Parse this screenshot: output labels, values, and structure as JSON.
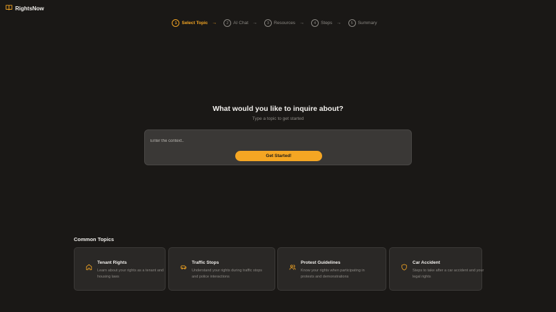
{
  "app": {
    "name": "RightsNow",
    "logo_icon": "book-open-icon"
  },
  "stepper": [
    {
      "num": "1",
      "label": "Select Topic",
      "active": true
    },
    {
      "num": "2",
      "label": "AI Chat",
      "active": false
    },
    {
      "num": "3",
      "label": "Resources",
      "active": false
    },
    {
      "num": "4",
      "label": "Steps",
      "active": false
    },
    {
      "num": "5",
      "label": "Summary",
      "active": false
    }
  ],
  "main": {
    "headline": "What would you like to inquire about?",
    "subline": "Type a topic to get started",
    "input_placeholder": "Enter the context..",
    "input_value": "",
    "cta_label": "Get Started!"
  },
  "common_topics": {
    "title": "Common Topics",
    "items": [
      {
        "title": "Tenant Rights",
        "description": "Learn about your rights as a tenant and housing laws",
        "icon": "home-icon"
      },
      {
        "title": "Traffic Stops",
        "description": "Understand your rights during traffic stops and police interactions",
        "icon": "car-icon"
      },
      {
        "title": "Protest Guidelines",
        "description": "Know your rights when participating in protests and demonstrations",
        "icon": "users-icon"
      },
      {
        "title": "Car Accident",
        "description": "Steps to take after a car accident and your legal rights",
        "icon": "shield-icon"
      }
    ]
  },
  "colors": {
    "accent": "#f5a623",
    "background": "#1a1816",
    "card": "#2a2826",
    "input_card": "#3a3836"
  }
}
